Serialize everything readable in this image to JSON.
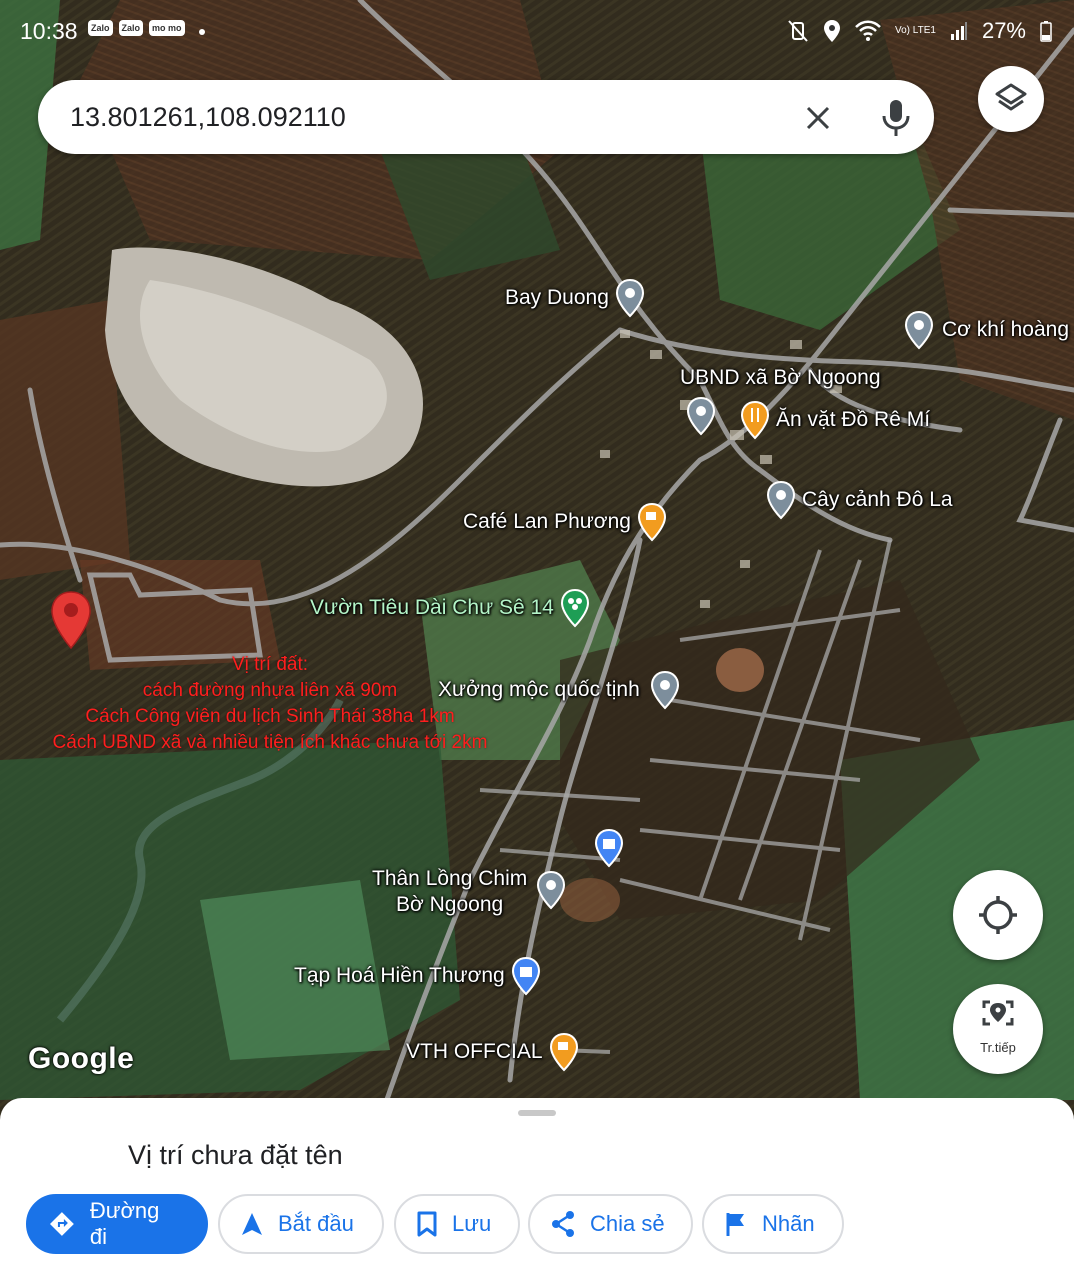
{
  "status_bar": {
    "time": "10:38",
    "apps": [
      "Zalo",
      "Zalo",
      "mo mo"
    ],
    "network": "Vo) LTE1",
    "battery": "27%"
  },
  "search": {
    "query": "13.801261,108.092110"
  },
  "map": {
    "pois": [
      {
        "name": "Bay Duong",
        "icon": "pin-icon"
      },
      {
        "name": "Cơ khí hoàng",
        "icon": "pin-icon"
      },
      {
        "name": "UBND xã Bờ Ngoong",
        "icon": "pin-icon"
      },
      {
        "name": "Ăn vặt Đồ Rê Mí",
        "icon": "restaurant-icon"
      },
      {
        "name": "Cây cảnh Đô La",
        "icon": "pin-icon"
      },
      {
        "name": "Café Lan Phương",
        "icon": "cafe-icon"
      },
      {
        "name": "Vườn Tiêu Dài Chư Sê 14",
        "icon": "park-icon"
      },
      {
        "name": "Xưởng mộc quốc tịnh",
        "icon": "pin-icon"
      },
      {
        "name": "Thân Lồng Chim",
        "name2": "Bờ Ngoong",
        "icon": "pin-icon"
      },
      {
        "name": "Tạp Hoá Hiền Thương",
        "icon": "shopping-bag-icon"
      },
      {
        "name": "VTH OFFCIAL",
        "icon": "cafe-icon"
      }
    ],
    "note_lines": [
      "Vị trí đất:",
      "cách đường nhựa liên xã 90m",
      "Cách Công viên du lịch Sinh Thái 38ha 1km",
      "Cách UBND xã và nhiều tiện ích khác chưa tới 2km"
    ],
    "logo": "Google",
    "follow_label": "Tr.tiếp",
    "colors": {
      "pin_red": "#e53935",
      "note_red": "#ff1e1e",
      "accent_blue": "#1a73e8"
    }
  },
  "sheet": {
    "place_title": "Vị trí chưa đặt tên",
    "actions": [
      {
        "label": "Đường đi",
        "icon": "directions-icon"
      },
      {
        "label": "Bắt đầu",
        "icon": "navigation-icon"
      },
      {
        "label": "Lưu",
        "icon": "bookmark-icon"
      },
      {
        "label": "Chia sẻ",
        "icon": "share-icon"
      },
      {
        "label": "Nhãn",
        "icon": "flag-icon"
      }
    ]
  }
}
